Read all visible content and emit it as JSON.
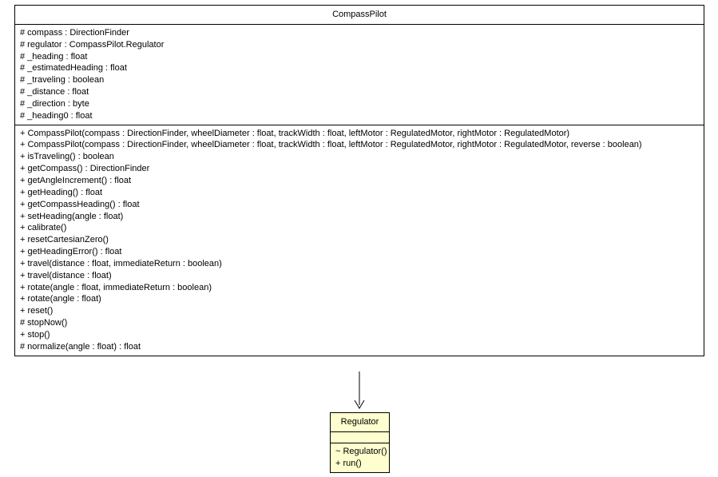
{
  "classes": {
    "compassPilot": {
      "name": "CompassPilot",
      "attributes": [
        "# compass : DirectionFinder",
        "# regulator : CompassPilot.Regulator",
        "# _heading : float",
        "# _estimatedHeading : float",
        "# _traveling : boolean",
        "# _distance : float",
        "# _direction : byte",
        "# _heading0 : float"
      ],
      "methods": [
        "+ CompassPilot(compass : DirectionFinder, wheelDiameter : float, trackWidth : float, leftMotor : RegulatedMotor, rightMotor : RegulatedMotor)",
        "+ CompassPilot(compass : DirectionFinder, wheelDiameter : float, trackWidth : float, leftMotor : RegulatedMotor, rightMotor : RegulatedMotor, reverse : boolean)",
        "+ isTraveling() : boolean",
        "+ getCompass() : DirectionFinder",
        "+ getAngleIncrement() : float",
        "+ getHeading() : float",
        "+ getCompassHeading() : float",
        "+ setHeading(angle : float)",
        "+ calibrate()",
        "+ resetCartesianZero()",
        "+ getHeadingError() : float",
        "+ travel(distance : float, immediateReturn : boolean)",
        "+ travel(distance : float)",
        "+ rotate(angle : float, immediateReturn : boolean)",
        "+ rotate(angle : float)",
        "+ reset()",
        "# stopNow()",
        "+ stop()",
        "# normalize(angle : float) : float"
      ]
    },
    "regulator": {
      "name": "Regulator",
      "attributes": [],
      "methods": [
        "~ Regulator()",
        "+ run()"
      ]
    }
  }
}
